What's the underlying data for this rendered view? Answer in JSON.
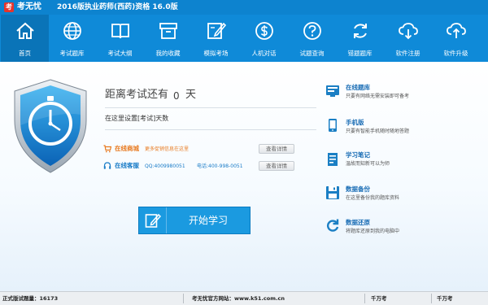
{
  "app": {
    "logo_char": "考",
    "brand": "考无忧",
    "title": "2016版执业药师(西药)资格 16.0版"
  },
  "nav": {
    "items": [
      {
        "label": "首页",
        "icon": "home-icon"
      },
      {
        "label": "考试题库",
        "icon": "globe-icon"
      },
      {
        "label": "考试大纲",
        "icon": "book-icon"
      },
      {
        "label": "我的收藏",
        "icon": "box-icon"
      },
      {
        "label": "模拟考场",
        "icon": "edit-icon"
      },
      {
        "label": "人机对话",
        "icon": "dollar-cycle-icon"
      },
      {
        "label": "试题查询",
        "icon": "help-icon"
      },
      {
        "label": "错题题库",
        "icon": "refresh-icon"
      },
      {
        "label": "软件注册",
        "icon": "cloud-download-icon"
      },
      {
        "label": "软件升级",
        "icon": "cloud-upload-icon"
      }
    ]
  },
  "countdown": {
    "prefix": "距离考试还有",
    "days": "0",
    "unit": "天",
    "setting": "在这里设置[考试]天数"
  },
  "online_mall": {
    "title": "在线商城",
    "desc": "更多促销信息在这里",
    "button": "查看详情"
  },
  "online_service": {
    "title": "在线客服",
    "qq": "QQ:4009980051",
    "phone": "电话:400-998-0051",
    "button": "查看详情"
  },
  "start_button": {
    "label": "开始学习"
  },
  "features": [
    {
      "title": "在线题库",
      "desc": "只要有网络无需安装即可备考",
      "icon": "online-bank-icon"
    },
    {
      "title": "手机版",
      "desc": "只要有智能手机随时随地答题",
      "icon": "mobile-icon"
    },
    {
      "title": "学习笔记",
      "desc": "温故而知新可以为师",
      "icon": "notes-icon"
    },
    {
      "title": "数据备份",
      "desc": "在这里备份我的题库资料",
      "icon": "backup-icon"
    },
    {
      "title": "数据还原",
      "desc": "将题库还原到我的电脑中",
      "icon": "restore-icon"
    }
  ],
  "status": {
    "version": "正式版试题量：16173",
    "site": "考无忧官方网站：www.k51.com.cn",
    "company": "千万考",
    "company2": "千万考"
  },
  "colors": {
    "titlebar": "#0d83cf",
    "navbar": "#0f8ad8",
    "accent": "#1b9ae0",
    "mall_orange": "#e8791f",
    "service_blue": "#1a7cc7"
  }
}
